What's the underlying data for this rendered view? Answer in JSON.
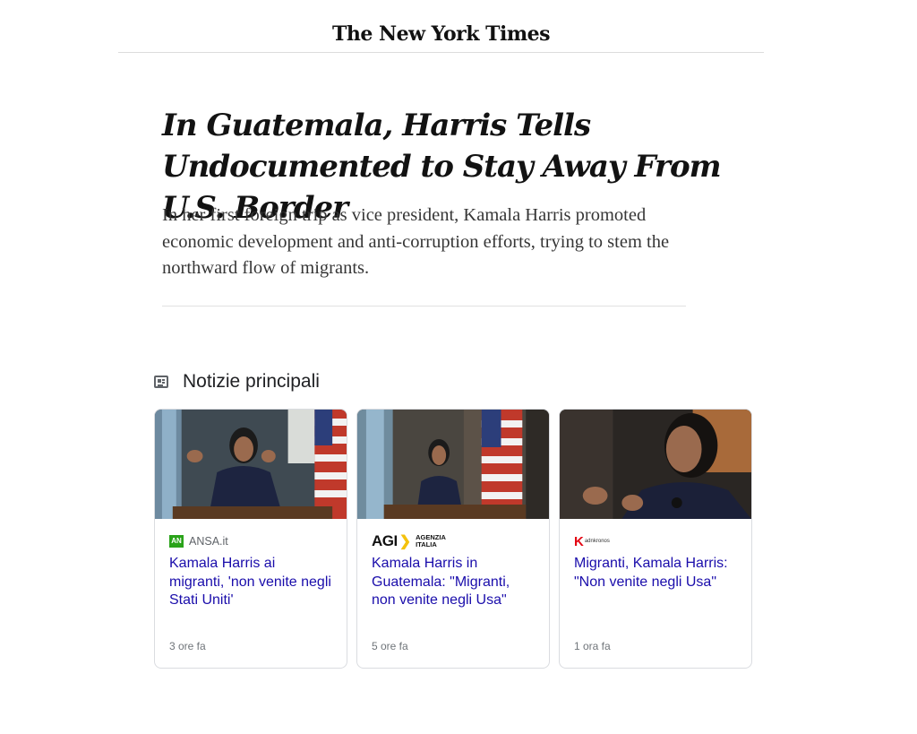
{
  "masthead": {
    "logo": "The New York Times"
  },
  "article": {
    "headline": "In Guatemala, Harris Tells Undocumented to Stay Away From U.S. Border",
    "summary": "In her first foreign trip as vice president, Kamala Harris promoted economic development and anti-corruption efforts, trying to stem the northward flow of migrants."
  },
  "top_stories": {
    "icon": "newspaper-icon",
    "title": "Notizie principali",
    "cards": [
      {
        "source": "ANSA.it",
        "logo_text": "AN",
        "logo_color": "#2aa31a",
        "title": "Kamala Harris ai migranti, 'non venite negli Stati Uniti'",
        "time": "3 ore fa"
      },
      {
        "source": "AGENZIA ITALIA",
        "logo_text": "AGI",
        "logo_color": "#f4c20d",
        "title": "Kamala Harris in Guatemala: \"Migranti, non venite negli Usa\"",
        "time": "5 ore fa"
      },
      {
        "source": "adnkronos",
        "logo_text": "K",
        "logo_color": "#e30613",
        "title": "Migranti, Kamala Harris: \"Non venite negli Usa\"",
        "time": "1 ora fa"
      }
    ]
  }
}
